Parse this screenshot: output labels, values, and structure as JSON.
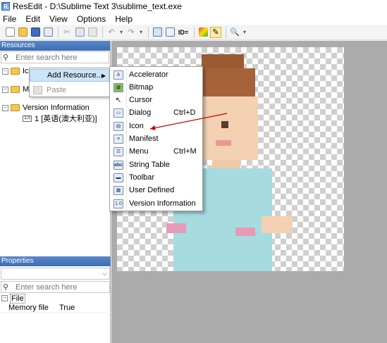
{
  "window": {
    "title": "ResEdit - D:\\Sublime Text 3\\sublime_text.exe",
    "app_icon_letter": "R"
  },
  "menubar": [
    "File",
    "Edit",
    "View",
    "Options",
    "Help"
  ],
  "toolbar": {
    "buttons": [
      "new-file-icon",
      "open-folder-icon",
      "save-icon",
      "print-preview-icon",
      "cut-icon",
      "copy-icon",
      "paste-icon",
      "undo-icon",
      "redo-icon",
      "view-grid-icon",
      "dialog-icon",
      "id-icon",
      "color-icon",
      "pencil-icon",
      "zoom-icon"
    ],
    "id_label": "ID="
  },
  "resources_panel": {
    "header": "Resources",
    "search_placeholder": "Enter search here",
    "tree": [
      {
        "label": "Ic",
        "type": "folder",
        "expanded": true
      },
      {
        "label": "M",
        "type": "folder",
        "expanded": true
      },
      {
        "label": "Version Information",
        "type": "folder",
        "expanded": true
      },
      {
        "label": "1 [英语(澳大利亚)]",
        "type": "version"
      }
    ]
  },
  "context_menu": {
    "items": [
      {
        "label": "Add Resource...",
        "has_submenu": true,
        "enabled": true,
        "highlighted": true
      },
      {
        "label": "Paste",
        "enabled": false
      }
    ]
  },
  "submenu": {
    "items": [
      {
        "label": "Accelerator",
        "icon": "accelerator-icon",
        "shortcut": ""
      },
      {
        "label": "Bitmap",
        "icon": "bitmap-icon",
        "shortcut": ""
      },
      {
        "label": "Cursor",
        "icon": "cursor-icon",
        "shortcut": ""
      },
      {
        "label": "Dialog",
        "icon": "dialog-icon",
        "shortcut": "Ctrl+D"
      },
      {
        "label": "Icon",
        "icon": "icon-resource-icon",
        "shortcut": ""
      },
      {
        "label": "Manifest",
        "icon": "manifest-icon",
        "shortcut": ""
      },
      {
        "label": "Menu",
        "icon": "menu-icon",
        "shortcut": "Ctrl+M"
      },
      {
        "label": "String Table",
        "icon": "string-table-icon",
        "shortcut": ""
      },
      {
        "label": "Toolbar",
        "icon": "toolbar-icon",
        "shortcut": ""
      },
      {
        "label": "User Defined",
        "icon": "user-defined-icon",
        "shortcut": ""
      },
      {
        "label": "Version Information",
        "icon": "version-info-icon",
        "shortcut": ""
      }
    ]
  },
  "properties_panel": {
    "header": "Properties",
    "search_placeholder": "Enter search here",
    "group": "File",
    "rows": [
      {
        "key": "Memory file",
        "value": "True"
      }
    ]
  },
  "colors": {
    "panel_header": "#4a7cc0",
    "highlight": "#cce4f7",
    "workspace": "#ababab",
    "annotation_arrow": "#cc0000"
  }
}
